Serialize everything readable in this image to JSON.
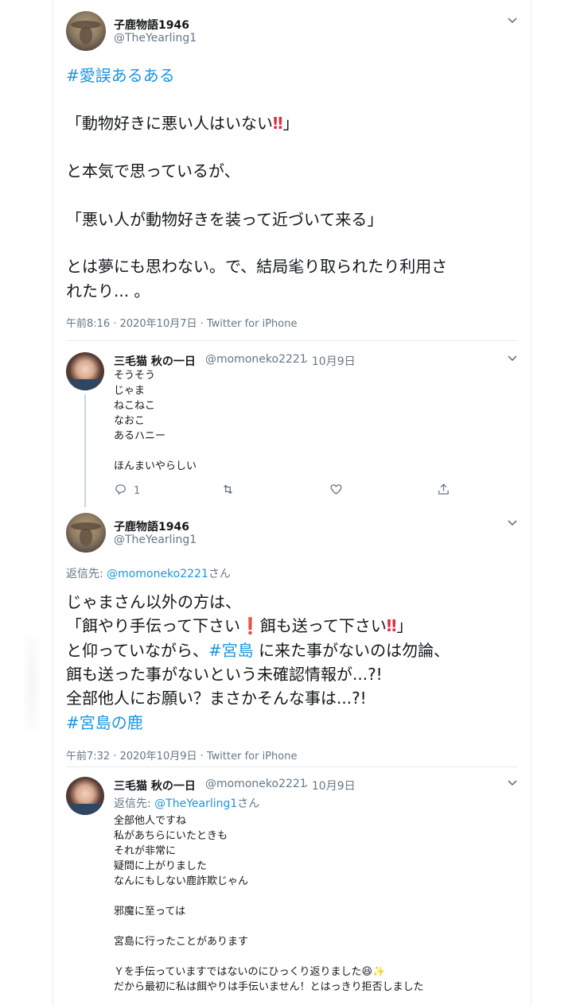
{
  "tweet1": {
    "name": "子鹿物語1946",
    "handle": "@TheYearling1",
    "hashtag": "#愛誤あるある",
    "line1_a": "「動物好きに悪い人はいない",
    "line1_emoji": "‼",
    "line1_b": "」",
    "line2": "と本気で思っているが、",
    "line3": "「悪い人が動物好きを装って近づいて来る」",
    "line4": "とは夢にも思わない。で、結局毟り取られたり利用さ",
    "line5": "れたり... 。",
    "meta": "午前8:16 · 2020年10月7日 · Twitter for iPhone"
  },
  "reply1": {
    "name": "三毛猫 秋の一日",
    "handle": "@momoneko2221",
    "date": "· 10月9日",
    "lines": [
      "そうそう",
      "じゃま",
      "ねこねこ",
      "なおこ",
      "あるハニー",
      "",
      "ほんまいやらしい"
    ],
    "reply_count": "1"
  },
  "tweet2": {
    "name": "子鹿物語1946",
    "handle": "@TheYearling1",
    "reply_to_label": "返信先: ",
    "reply_to_handle": "@momoneko2221",
    "reply_to_suffix": "さん",
    "line1": "じゃまさん以外の方は、",
    "line2_a": "「餌やり手伝って下さい",
    "line2_emoji1": "❗",
    "line2_b": "餌も送って下さい",
    "line2_emoji2": "‼",
    "line2_c": "」",
    "line3_a": "と仰っていながら、",
    "line3_tag": "#宮島",
    "line3_b": " に来た事がないのは勿論、",
    "line4": "餌も送った事がないという未確認情報が...?!",
    "line5": "全部他人にお願い？まさかそんな事は...?!",
    "hashtag": "#宮島の鹿",
    "meta": "午前7:32 · 2020年10月9日 · Twitter for iPhone"
  },
  "reply2": {
    "name": "三毛猫 秋の一日",
    "handle": "@momoneko2221",
    "date": "· 10月9日",
    "reply_to_label": "返信先: ",
    "reply_to_handle": "@TheYearling1",
    "reply_to_suffix": "さん",
    "lines": [
      "全部他人ですね",
      "私があちらにいたときも",
      "それが非常に",
      "疑問に上がりました",
      "なんにもしない鹿詐欺じゃん",
      "",
      "邪魔に至っては",
      "",
      "宮島に行ったことがあります",
      "",
      "Ｙを手伝っていますではないのにひっくり返りました😆✨",
      "だから最初に私は餌やりは手伝いません！とはっきり拒否しました"
    ]
  }
}
